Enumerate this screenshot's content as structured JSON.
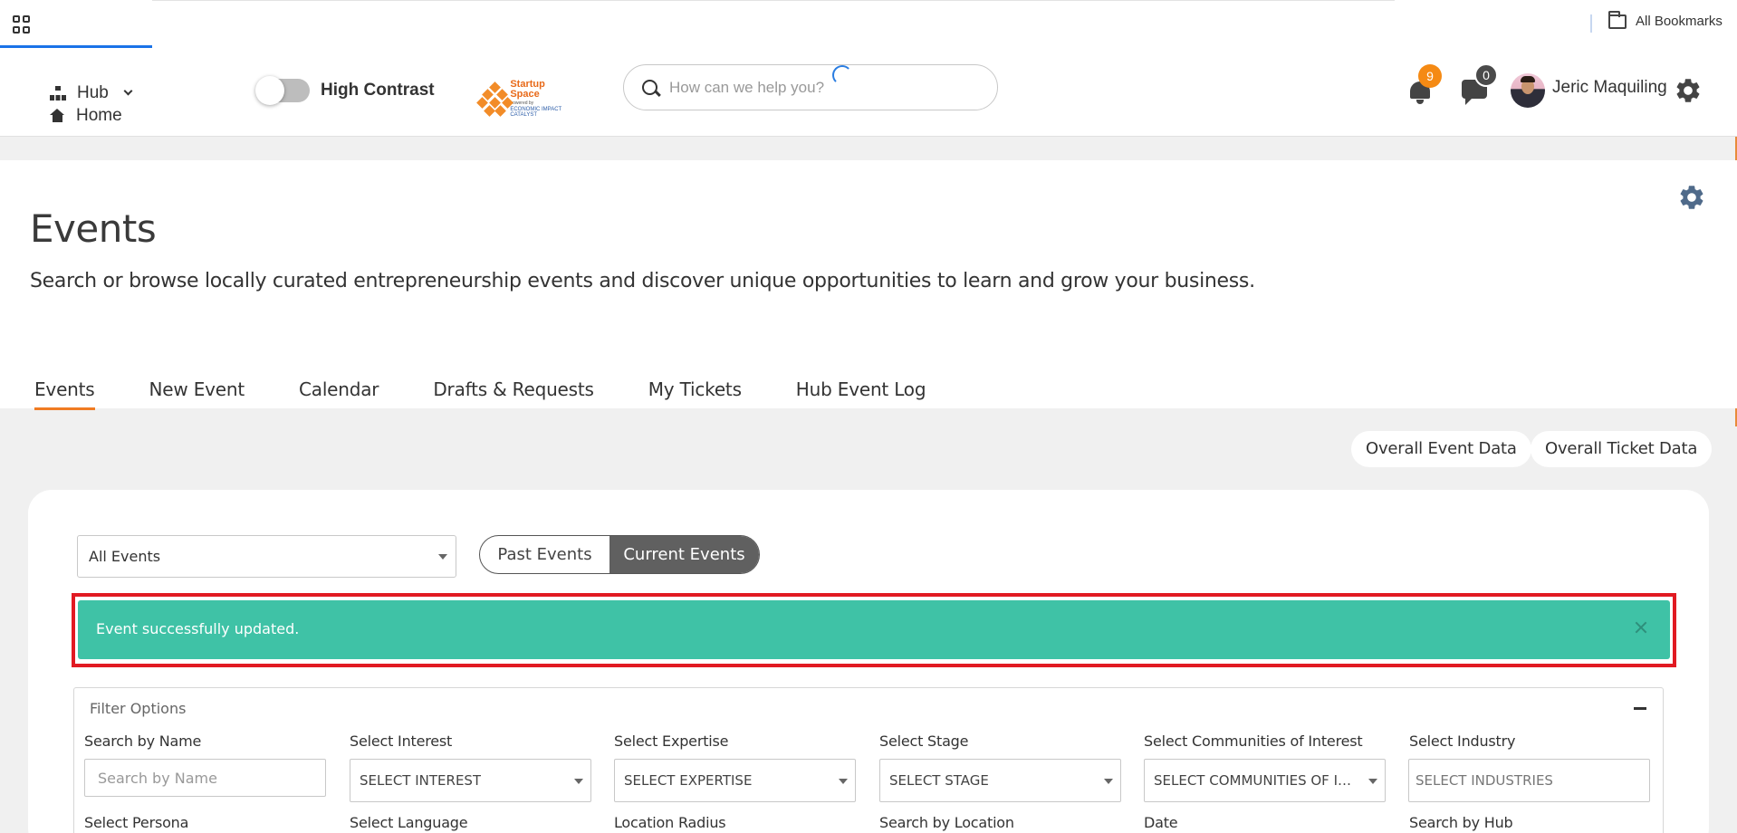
{
  "browser": {
    "bookmarks_label": "All Bookmarks"
  },
  "header": {
    "hub_label": "Hub",
    "home_label": "Home",
    "high_contrast_label": "High Contrast",
    "logo": {
      "name": "Startup Space",
      "powered_by": "powered by",
      "partner": "ECONOMIC IMPACT CATALYST"
    },
    "search_placeholder": "How can we help you?",
    "notifications_count": "9",
    "messages_count": "0",
    "user_name": "Jeric Maquiling"
  },
  "page": {
    "title": "Events",
    "subtitle": "Search or browse locally curated entrepreneurship events and discover unique opportunities to learn and grow your business.",
    "tabs": [
      {
        "label": "Events",
        "active": true
      },
      {
        "label": "New Event",
        "active": false
      },
      {
        "label": "Calendar",
        "active": false
      },
      {
        "label": "Drafts & Requests",
        "active": false
      },
      {
        "label": "My Tickets",
        "active": false
      },
      {
        "label": "Hub Event Log",
        "active": false
      }
    ],
    "overall_event_data_label": "Overall Event Data",
    "overall_ticket_data_label": "Overall Ticket Data"
  },
  "controls": {
    "events_filter_value": "All Events",
    "past_events_label": "Past Events",
    "current_events_label": "Current Events",
    "active_segment": "Current Events"
  },
  "alert": {
    "message": "Event successfully updated.",
    "color": "#3fc2a6",
    "highlight_color": "#e11a22"
  },
  "filters": {
    "title": "Filter Options",
    "row1": [
      {
        "label": "Search by Name",
        "type": "input",
        "placeholder": "Search by Name"
      },
      {
        "label": "Select Interest",
        "type": "select",
        "value": "SELECT INTEREST"
      },
      {
        "label": "Select Expertise",
        "type": "select",
        "value": "SELECT EXPERTISE"
      },
      {
        "label": "Select Stage",
        "type": "select",
        "value": "SELECT STAGE"
      },
      {
        "label": "Select Communities of Interest",
        "type": "select",
        "value": "SELECT COMMUNITIES OF INTEREST"
      },
      {
        "label": "Select Industry",
        "type": "multiselect",
        "value": "SELECT INDUSTRIES"
      }
    ],
    "row2_labels": [
      "Select Persona",
      "Select Language",
      "Location Radius",
      "Search by Location",
      "Date",
      "Search by Hub"
    ]
  },
  "theme": {
    "accent": "#f07b22",
    "notification_badge": "#f58a14"
  }
}
